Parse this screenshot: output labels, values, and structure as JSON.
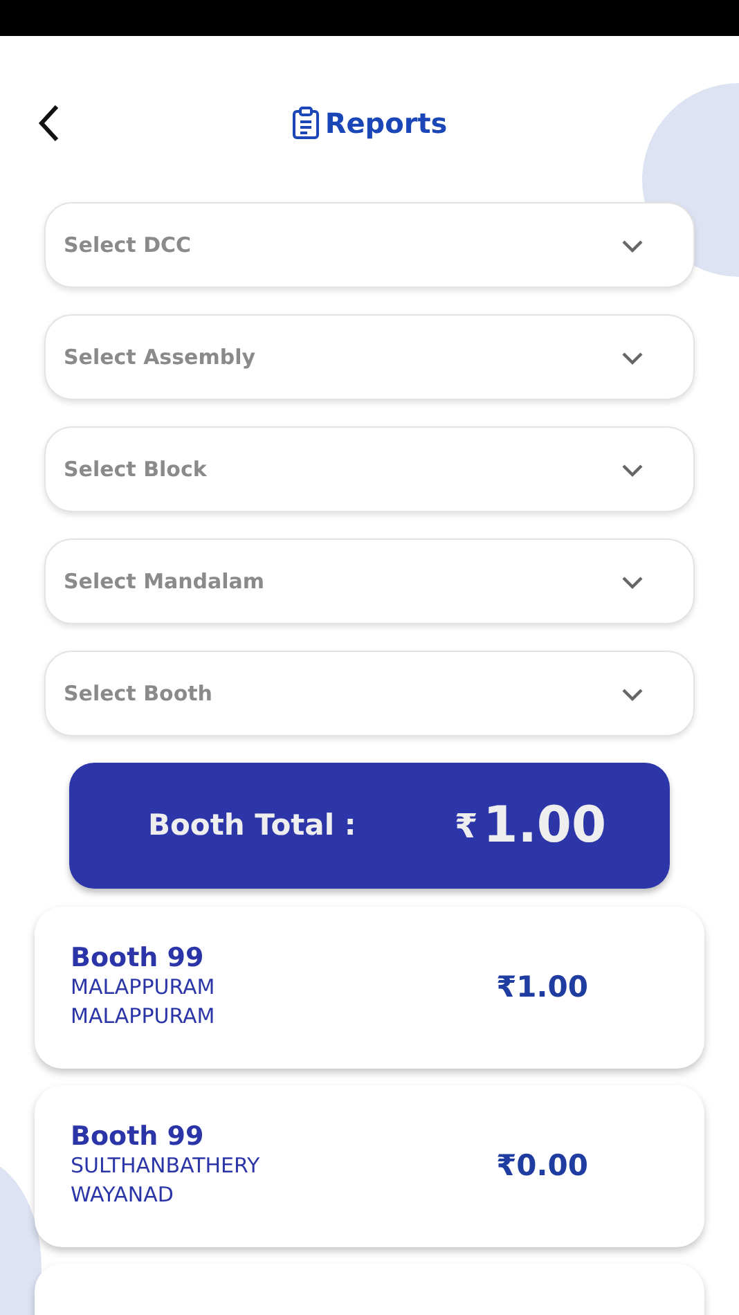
{
  "header": {
    "title": "Reports"
  },
  "dropdowns": [
    {
      "placeholder": "Select DCC"
    },
    {
      "placeholder": "Select Assembly"
    },
    {
      "placeholder": "Select Block"
    },
    {
      "placeholder": "Select Mandalam"
    },
    {
      "placeholder": "Select Booth"
    }
  ],
  "total": {
    "label": "Booth Total :",
    "currency": "₹",
    "amount": "1.00"
  },
  "booths": [
    {
      "kind": "booth",
      "name": "Booth 99",
      "line_1": "MALAPPURAM",
      "line_2": "MALAPPURAM",
      "amount": "₹1.00"
    },
    {
      "kind": "booth",
      "name": "Booth 99",
      "line_1": "SULTHANBATHERY",
      "line_2": "WAYANAD",
      "amount": "₹0.00"
    },
    {
      "kind": "empty"
    }
  ]
}
